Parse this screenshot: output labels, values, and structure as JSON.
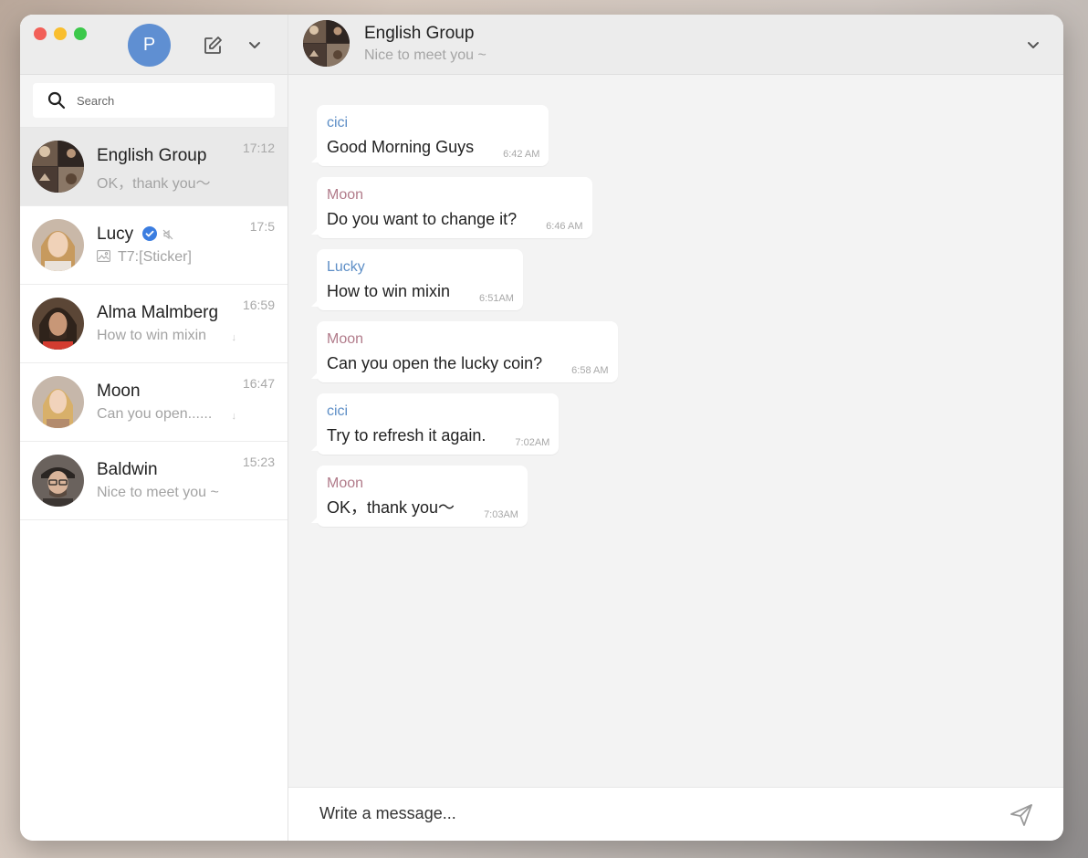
{
  "sidebar": {
    "me_avatar_letter": "P",
    "search_placeholder": "Search",
    "chats": [
      {
        "name": "English Group",
        "preview": "OK，thank you～",
        "time": "17:12",
        "active": true
      },
      {
        "name": "Lucy",
        "preview": "T7:[Sticker]",
        "time": "17:5",
        "verified": true,
        "muted": true
      },
      {
        "name": "Alma Malmberg",
        "preview": "How to win mixin",
        "time": "16:59"
      },
      {
        "name": "Moon",
        "preview": "Can you open......",
        "time": "16:47"
      },
      {
        "name": "Baldwin",
        "preview": "Nice to meet you ~",
        "time": "15:23"
      }
    ]
  },
  "header": {
    "title": "English Group",
    "subtitle": "Nice to meet you ~"
  },
  "messages": [
    {
      "sender": "cici",
      "text": "Good Morning Guys",
      "time": "6:42 AM",
      "color": "#5d8ec6"
    },
    {
      "sender": "Moon",
      "text": "Do you want to change it?",
      "time": "6:46 AM",
      "color": "#b17b8a"
    },
    {
      "sender": "Lucky",
      "text": "How to win mixin",
      "time": "6:51AM",
      "color": "#5d8ec6"
    },
    {
      "sender": "Moon",
      "text": "Can you open the lucky coin?",
      "time": "6:58 AM",
      "color": "#b17b8a"
    },
    {
      "sender": "cici",
      "text": "Try to refresh it again.",
      "time": "7:02AM",
      "color": "#5d8ec6"
    },
    {
      "sender": "Moon",
      "text": "OK，thank you～",
      "time": "7:03AM",
      "color": "#b17b8a"
    }
  ],
  "composer": {
    "placeholder": "Write a message..."
  },
  "colors": {
    "accent": "#5f8fd2",
    "verified": "#3b7de0"
  }
}
